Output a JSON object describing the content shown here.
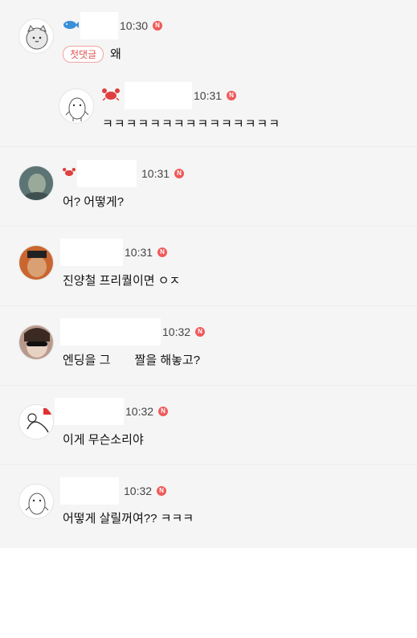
{
  "comments": [
    {
      "time": "10:30",
      "badge": "N",
      "first_label": "첫댓글",
      "text": "왜",
      "badge_icon": "fish-icon"
    },
    {
      "time": "10:31",
      "badge": "N",
      "text": "ㅋㅋㅋㅋㅋㅋㅋㅋㅋㅋㅋㅋㅋㅋㅋ",
      "badge_icon": "crab-icon",
      "reply": true
    },
    {
      "time": "10:31",
      "badge": "N",
      "text": "어? 어떻게?",
      "badge_icon": "crab-icon"
    },
    {
      "time": "10:31",
      "badge": "N",
      "text": "진양철 프리퀄이면 ㅇㅈ"
    },
    {
      "time": "10:32",
      "badge": "N",
      "text_before": "엔딩을 그",
      "text_after": "짤을 해놓고?"
    },
    {
      "time": "10:32",
      "badge": "N",
      "text": "이게 무슨소리야"
    },
    {
      "time": "10:32",
      "badge": "N",
      "text": "어떻게 살릴꺼여?? ㅋㅋㅋ"
    }
  ],
  "colors": {
    "badge": "#f05a5a",
    "background": "#f5f5f5",
    "first_tag": "#e15353"
  }
}
